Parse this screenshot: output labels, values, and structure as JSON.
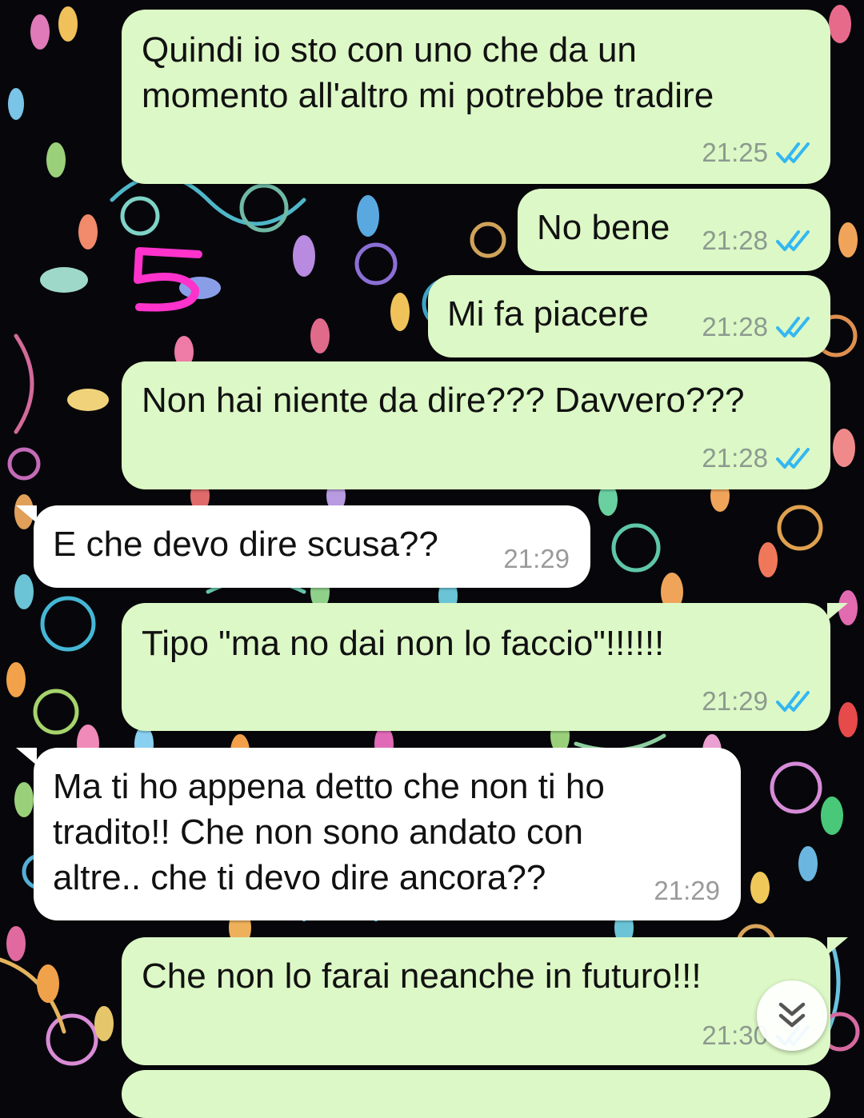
{
  "colors": {
    "outgoing_bubble": "#dcf8c6",
    "incoming_bubble": "#ffffff",
    "read_ticks": "#34b7f1",
    "wallpaper": "#07070b",
    "annotation_mark": "#ff33cc"
  },
  "annotation": {
    "mark": "5"
  },
  "messages": [
    {
      "direction": "out",
      "text": "Quindi io sto con uno che da un\nmomento all'altro mi potrebbe tradire",
      "time": "21:25",
      "status_icon": "double-check-read-icon"
    },
    {
      "direction": "out",
      "text": "No bene",
      "time": "21:28",
      "status_icon": "double-check-read-icon"
    },
    {
      "direction": "out",
      "text": "Mi fa piacere",
      "time": "21:28",
      "status_icon": "double-check-read-icon"
    },
    {
      "direction": "out",
      "text": "Non hai niente da dire??? Davvero???",
      "time": "21:28",
      "status_icon": "double-check-read-icon"
    },
    {
      "direction": "in",
      "text": "E che devo dire scusa??",
      "time": "21:29"
    },
    {
      "direction": "out",
      "text": "Tipo \"ma no dai non lo faccio\"!!!!!!",
      "time": "21:29",
      "status_icon": "double-check-read-icon"
    },
    {
      "direction": "in",
      "text": "Ma ti ho appena detto che non ti ho\ntradito!! Che non sono andato con\naltre.. che ti devo dire ancora??",
      "time": "21:29"
    },
    {
      "direction": "out",
      "text": "Che non lo farai neanche in futuro!!!",
      "time": "21:30",
      "status_icon": "double-check-read-icon"
    }
  ],
  "scroll_button": {
    "icon": "double-chevron-down-icon"
  }
}
